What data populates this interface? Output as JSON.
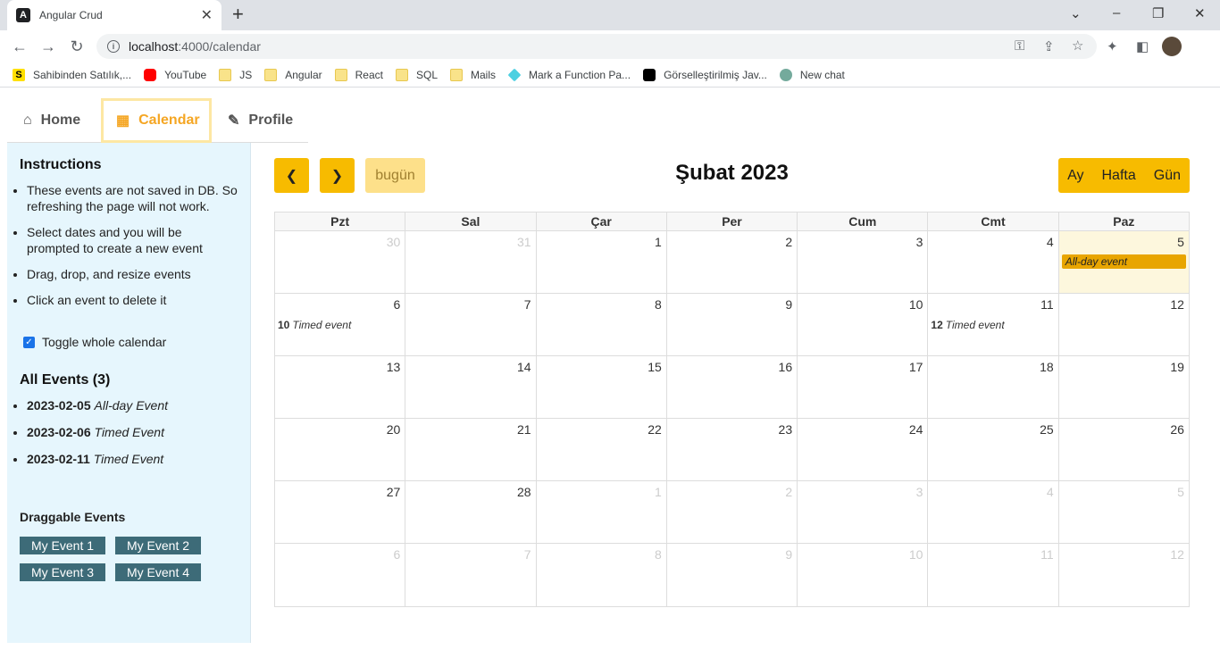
{
  "browser": {
    "tab_title": "Angular Crud",
    "favicon": "A",
    "url_host": "localhost",
    "url_path": ":4000/calendar",
    "bookmarks": [
      {
        "label": "Sahibinden Satılık,...",
        "icon": "s-icon"
      },
      {
        "label": "YouTube",
        "icon": "youtube-icon"
      },
      {
        "label": "JS",
        "icon": "folder-icon"
      },
      {
        "label": "Angular",
        "icon": "folder-icon"
      },
      {
        "label": "React",
        "icon": "folder-icon"
      },
      {
        "label": "SQL",
        "icon": "folder-icon"
      },
      {
        "label": "Mails",
        "icon": "folder-icon"
      },
      {
        "label": "Mark a Function Pa...",
        "icon": "gem-icon"
      },
      {
        "label": "Görselleştirilmiş Jav...",
        "icon": "observable-icon"
      },
      {
        "label": "New chat",
        "icon": "chatgpt-icon"
      }
    ]
  },
  "nav": {
    "home": "Home",
    "calendar": "Calendar",
    "profile": "Profile"
  },
  "sidebar": {
    "instructions_title": "Instructions",
    "instructions": [
      "These events are not saved in DB. So refreshing the page will not work.",
      "Select dates and you will be prompted to create a new event",
      "Drag, drop, and resize events",
      "Click an event to delete it"
    ],
    "toggle_label": "Toggle whole calendar",
    "toggle_checked": true,
    "events_title": "All Events (3)",
    "events": [
      {
        "date": "2023-02-05",
        "title": "All-day Event"
      },
      {
        "date": "2023-02-06",
        "title": "Timed Event"
      },
      {
        "date": "2023-02-11",
        "title": "Timed Event"
      }
    ],
    "draggable_title": "Draggable Events",
    "draggable": [
      "My Event 1",
      "My Event 2",
      "My Event 3",
      "My Event 4"
    ]
  },
  "calendar": {
    "title": "Şubat 2023",
    "prev_icon": "chevron-left-icon",
    "next_icon": "chevron-right-icon",
    "today_label": "bugün",
    "views": [
      "Ay",
      "Hafta",
      "Gün"
    ],
    "weekdays": [
      "Pzt",
      "Sal",
      "Çar",
      "Per",
      "Cum",
      "Cmt",
      "Paz"
    ],
    "accent": "#f7bb00",
    "weeks": [
      [
        {
          "n": "30",
          "o": true
        },
        {
          "n": "31",
          "o": true
        },
        {
          "n": "1"
        },
        {
          "n": "2"
        },
        {
          "n": "3"
        },
        {
          "n": "4"
        },
        {
          "n": "5",
          "today": true,
          "allday": "All-day event"
        }
      ],
      [
        {
          "n": "6",
          "time": "10",
          "ev": "Timed event"
        },
        {
          "n": "7"
        },
        {
          "n": "8"
        },
        {
          "n": "9"
        },
        {
          "n": "10"
        },
        {
          "n": "11",
          "time": "12",
          "ev": "Timed event"
        },
        {
          "n": "12"
        }
      ],
      [
        {
          "n": "13"
        },
        {
          "n": "14"
        },
        {
          "n": "15"
        },
        {
          "n": "16"
        },
        {
          "n": "17"
        },
        {
          "n": "18"
        },
        {
          "n": "19"
        }
      ],
      [
        {
          "n": "20"
        },
        {
          "n": "21"
        },
        {
          "n": "22"
        },
        {
          "n": "23"
        },
        {
          "n": "24"
        },
        {
          "n": "25"
        },
        {
          "n": "26"
        }
      ],
      [
        {
          "n": "27"
        },
        {
          "n": "28"
        },
        {
          "n": "1",
          "o": true
        },
        {
          "n": "2",
          "o": true
        },
        {
          "n": "3",
          "o": true
        },
        {
          "n": "4",
          "o": true
        },
        {
          "n": "5",
          "o": true
        }
      ],
      [
        {
          "n": "6",
          "o": true
        },
        {
          "n": "7",
          "o": true
        },
        {
          "n": "8",
          "o": true
        },
        {
          "n": "9",
          "o": true
        },
        {
          "n": "10",
          "o": true
        },
        {
          "n": "11",
          "o": true
        },
        {
          "n": "12",
          "o": true
        }
      ]
    ]
  }
}
